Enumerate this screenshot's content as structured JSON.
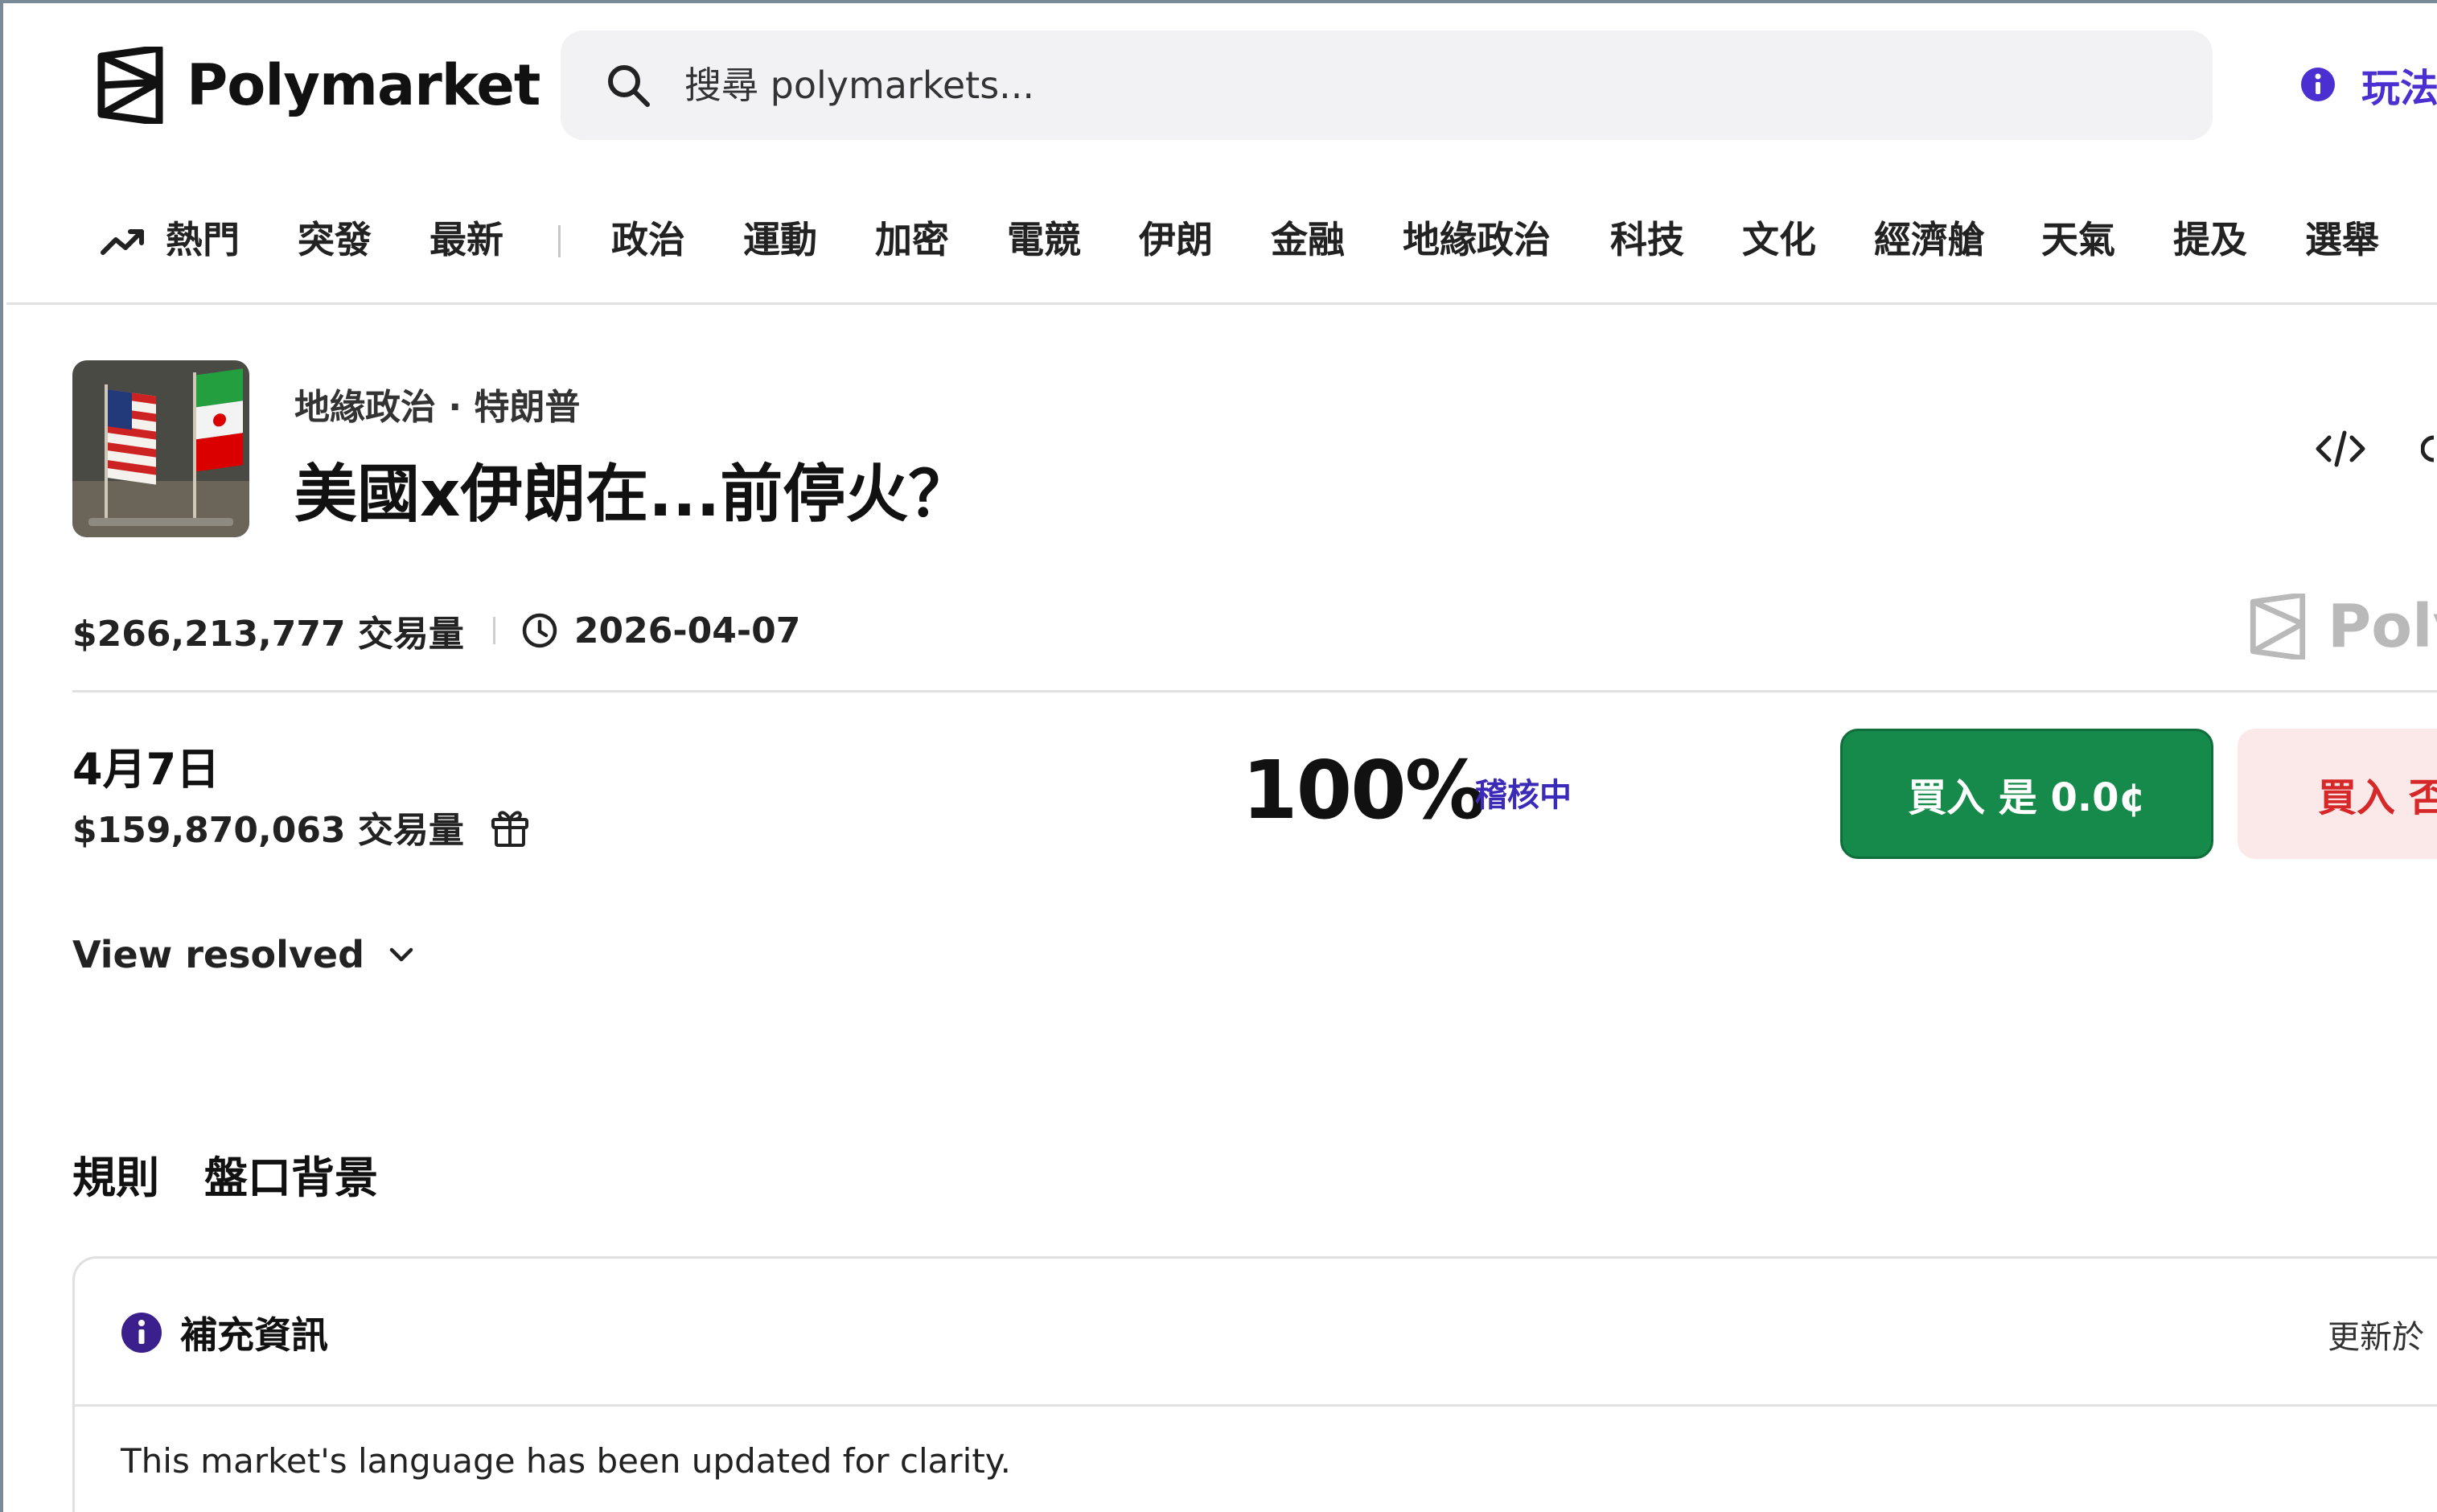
{
  "brand": {
    "name": "Polymarket",
    "logo_icon": "polymarket-logo-icon"
  },
  "search": {
    "placeholder": "搜尋 polymarkets..."
  },
  "header": {
    "howto_label": "玩法"
  },
  "nav": {
    "items": [
      {
        "label": "熱門",
        "icon": "trending-icon"
      },
      {
        "label": "突發"
      },
      {
        "label": "最新"
      },
      {
        "label": "政治"
      },
      {
        "label": "運動"
      },
      {
        "label": "加密"
      },
      {
        "label": "電競"
      },
      {
        "label": "伊朗"
      },
      {
        "label": "金融"
      },
      {
        "label": "地緣政治"
      },
      {
        "label": "科技"
      },
      {
        "label": "文化"
      },
      {
        "label": "經濟艙"
      },
      {
        "label": "天氣"
      },
      {
        "label": "提及"
      },
      {
        "label": "選舉"
      }
    ]
  },
  "market": {
    "breadcrumb": "地緣政治 · 特朗普",
    "title": "美國x伊朗在...前停火？",
    "volume": "$266,213,777 交易量",
    "end_date": "2026-04-07",
    "watermark": "Poly"
  },
  "outcome": {
    "date": "4月7日",
    "volume": "$159,870,063 交易量",
    "probability": "100%",
    "status": "稽核中",
    "buy_yes": "買入 是 0.0¢",
    "buy_no": "買入 否"
  },
  "view_resolved": "View resolved",
  "tabs": [
    {
      "label": "規則"
    },
    {
      "label": "盤口背景"
    }
  ],
  "info_card": {
    "title": "補充資訊",
    "updated": "更新於",
    "body": "This market's language has been updated for clarity."
  },
  "colors": {
    "accent": "#4b2fd0",
    "yes": "#168a4b",
    "no_bg": "#fbe9e9",
    "no_text": "#d62828",
    "status": "#3b2bb8"
  }
}
